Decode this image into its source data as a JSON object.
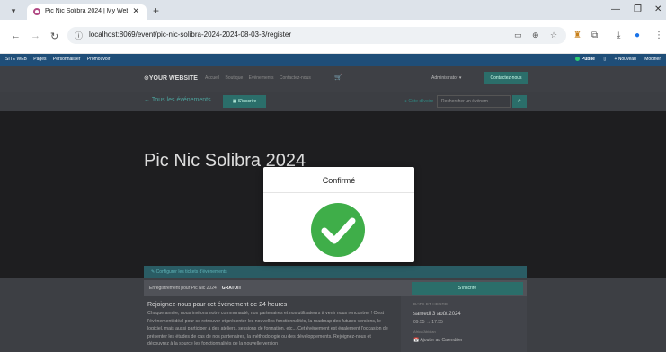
{
  "browser": {
    "tab_title": "Pic Nic Solibra 2024 | My Webs",
    "url": "localhost:8069/event/pic-nic-solibra-2024-2024-08-03-3/register"
  },
  "odoo_bar": {
    "app": "SITE WEB",
    "items": [
      "Pages",
      "Personnaliser",
      "Promouvoir"
    ],
    "publish": "Publié",
    "new": "+ Nouveau",
    "edit": "Modifier"
  },
  "site": {
    "logo": "YOUR WEBSITE",
    "nav": [
      "Accueil",
      "Boutique",
      "Événements",
      "Contactez-nous"
    ],
    "admin": "Administrator",
    "contact_button": "Contactez-nous"
  },
  "subbar": {
    "back": "← Tous les événements",
    "register_button": "S'inscrire",
    "location": "Côte d'Ivoire",
    "search_placeholder": "Rechercher un événem"
  },
  "event": {
    "title": "Pic Nic Solibra 2024",
    "configure": "Configurer les tickets d'événements",
    "registration_label": "Enregistrement pour Pic Nic 2024",
    "price": "GRATUIT",
    "register_button": "S'inscrire",
    "desc_title": "Rejoignez-nous pour cet événement de 24 heures",
    "desc_text": "Chaque année, nous invitons notre communauté, nos partenaires et nos utilisateurs à venir nous rencontrer ! C'est l'événement idéal pour se retrouver et présenter les nouvelles fonctionnalités, la roadmap des futures versions, le logiciel, mais aussi participer à des ateliers, sessions de formation, etc... Cet événement est également l'occasion de présenter les études de cas de nos partenaires, la méthodologie ou des développements. Rejoignez-nous et découvrez à la source les fonctionnalités de la nouvelle version !",
    "side_label": "DATE ET HEURE",
    "date": "samedi 3 août 2024",
    "time": "09:55 → 17:55",
    "timezone": "Africa/Abidjan",
    "calendar": "Ajouter au Calendrier"
  },
  "modal": {
    "title": "Confirmé"
  },
  "colors": {
    "success": "#3fae49",
    "odoo_bar": "#1f4e78",
    "teal": "#2b6e6a"
  }
}
